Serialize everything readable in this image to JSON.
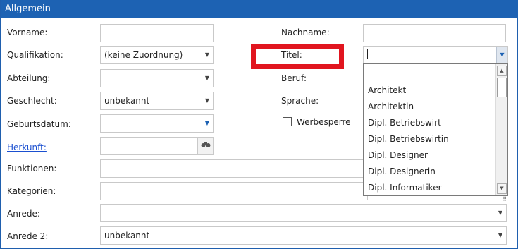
{
  "panel": {
    "title": "Allgemein"
  },
  "labels": {
    "vorname": "Vorname:",
    "nachname": "Nachname:",
    "qualifikation": "Qualifikation:",
    "titel": "Titel:",
    "abteilung": "Abteilung:",
    "beruf": "Beruf:",
    "geschlecht": "Geschlecht:",
    "sprache": "Sprache:",
    "geburtsdatum": "Geburtsdatum:",
    "werbesperre": "Werbesperre",
    "herkunft": "Herkunft:",
    "funktionen": "Funktionen:",
    "kategorien": "Kategorien:",
    "anrede": "Anrede:",
    "anrede2": "Anrede 2:"
  },
  "values": {
    "vorname": "",
    "nachname": "",
    "qualifikation": "(keine Zuordnung)",
    "titel": "",
    "abteilung": "",
    "geschlecht": "unbekannt",
    "geburtsdatum": "",
    "herkunft": "",
    "funktionen": "",
    "kategorien": "",
    "anrede": "",
    "anrede2": "unbekannt"
  },
  "werbesperre_checked": false,
  "titel_dropdown": {
    "items": [
      "",
      "Architekt",
      "Architektin",
      "Dipl. Betriebswirt",
      "Dipl. Betriebswirtin",
      "Dipl. Designer",
      "Dipl. Designerin",
      "Dipl. Informatiker"
    ]
  },
  "icons": {
    "dropdown_arrow": "▼",
    "scroll_up": "▲",
    "scroll_down": "▼",
    "search": "binoculars-icon",
    "resize_grip": "⠿"
  },
  "colors": {
    "header_bg": "#1d62b3",
    "highlight_border": "#e1151f",
    "link": "#1a4fd0"
  }
}
